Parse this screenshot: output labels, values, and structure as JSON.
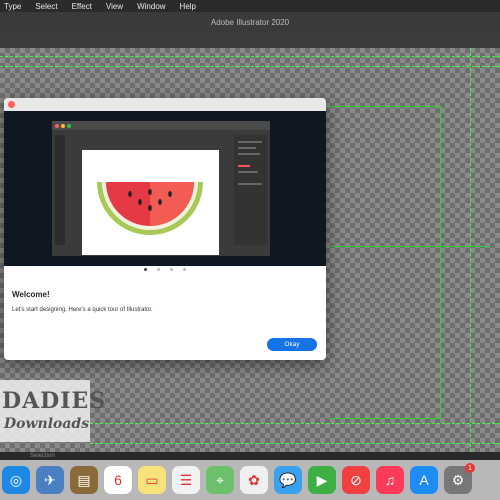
{
  "menubar": {
    "items": [
      "Type",
      "Select",
      "Effect",
      "View",
      "Window",
      "Help"
    ]
  },
  "window": {
    "title": "Adobe Illustrator 2020"
  },
  "statusbar": {
    "label": "Selection"
  },
  "dialog": {
    "title": "Welcome!",
    "body": "Let's start designing. Here's a quick tour of Illustrator.",
    "button": "Okay",
    "pages": 4,
    "active_page": 1
  },
  "watermark": {
    "line1": "DADIES",
    "line2": "Downloads"
  },
  "dock": {
    "icons": [
      {
        "name": "safari-icon",
        "glyph": "◎",
        "color": "#1e88e5"
      },
      {
        "name": "mail-icon",
        "glyph": "✈",
        "color": "#4a7fc1"
      },
      {
        "name": "notebook-icon",
        "glyph": "▤",
        "color": "#8b6a3a"
      },
      {
        "name": "calendar-icon",
        "glyph": "6",
        "color": "#ffffff"
      },
      {
        "name": "notes-icon",
        "glyph": "▭",
        "color": "#f7e37a"
      },
      {
        "name": "reminders-icon",
        "glyph": "☰",
        "color": "#f2f2f2"
      },
      {
        "name": "maps-icon",
        "glyph": "⌖",
        "color": "#6cc06c"
      },
      {
        "name": "photos-icon",
        "glyph": "✿",
        "color": "#f0f0f0"
      },
      {
        "name": "messages-icon",
        "glyph": "💬",
        "color": "#3aa0f0"
      },
      {
        "name": "facetime-icon",
        "glyph": "▶",
        "color": "#3cb043"
      },
      {
        "name": "news-icon",
        "glyph": "⊘",
        "color": "#f04040"
      },
      {
        "name": "music-icon",
        "glyph": "♫",
        "color": "#fa3c5a"
      },
      {
        "name": "appstore-icon",
        "glyph": "A",
        "color": "#1d8cf5"
      },
      {
        "name": "system-preferences-icon",
        "glyph": "⚙",
        "color": "#777777"
      }
    ],
    "badge": "1"
  },
  "colors": {
    "guide": "#3cff3c",
    "accent": "#1473e6"
  }
}
